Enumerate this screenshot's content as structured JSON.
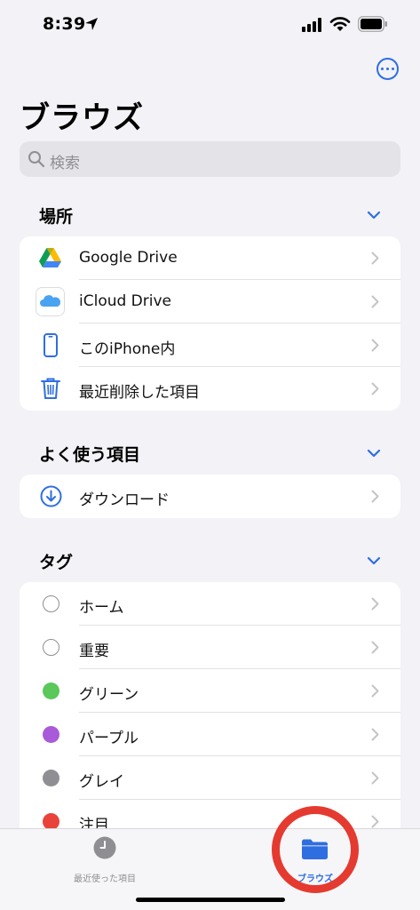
{
  "status_bar": {
    "time": "8:39"
  },
  "header": {
    "title": "ブラウズ"
  },
  "search": {
    "placeholder": "検索"
  },
  "sections": {
    "locations": {
      "title": "場所",
      "items": [
        {
          "label": "Google Drive",
          "icon": "google-drive-icon"
        },
        {
          "label": "iCloud Drive",
          "icon": "icloud-icon"
        },
        {
          "label": "このiPhone内",
          "icon": "iphone-icon"
        },
        {
          "label": "最近削除した項目",
          "icon": "trash-icon"
        }
      ]
    },
    "favorites": {
      "title": "よく使う項目",
      "items": [
        {
          "label": "ダウンロード",
          "icon": "download-icon"
        }
      ]
    },
    "tags": {
      "title": "タグ",
      "items": [
        {
          "label": "ホーム",
          "color": "#ffffff"
        },
        {
          "label": "重要",
          "color": "#ffffff"
        },
        {
          "label": "グリーン",
          "color": "#5ac85a"
        },
        {
          "label": "パープル",
          "color": "#a95ad8"
        },
        {
          "label": "グレイ",
          "color": "#8e8e93"
        },
        {
          "label": "注目",
          "color": "#e8423a"
        }
      ]
    }
  },
  "tab_bar": {
    "recents_label": "最近使った項目",
    "browse_label": "ブラウズ",
    "active_color": "#2f6ee0"
  },
  "colors": {
    "accent": "#2f6ee0",
    "highlight_ring": "#e53a2f"
  }
}
